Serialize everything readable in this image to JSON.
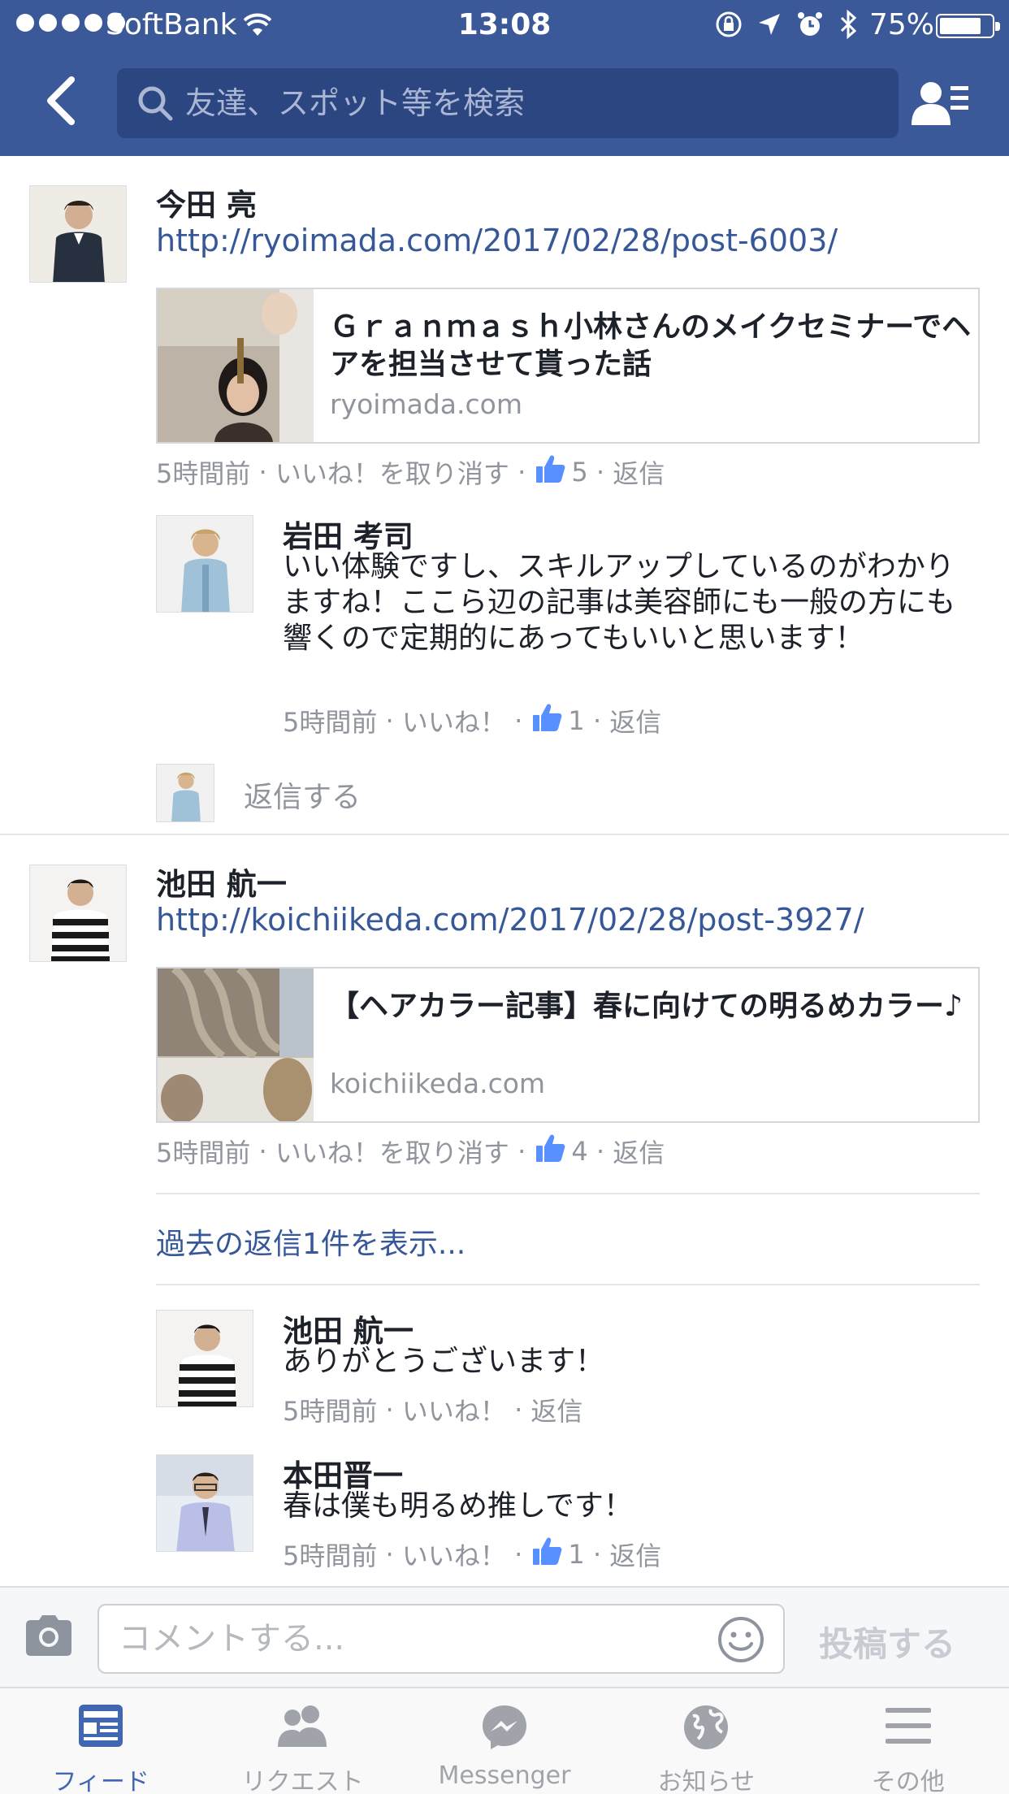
{
  "status_bar": {
    "carrier": "SoftBank",
    "time": "13:08",
    "battery": "75%",
    "battery_level": 0.75
  },
  "nav": {
    "search_placeholder": "友達、スポット等を検索"
  },
  "posts": [
    {
      "author": "今田 亮",
      "link": "http://ryoimada.com/2017/02/28/post-6003/",
      "card": {
        "title": "Ｇｒａｎｍａｓｈ小林さんのメイクセミナーでヘアを担当させて貰った話",
        "domain": "ryoimada.com"
      },
      "meta": {
        "time": "5時間前",
        "like": "いいね！を取り消す",
        "likes": "5",
        "reply": "返信"
      },
      "replies": [
        {
          "author": "岩田 考司",
          "text": "いい体験ですし、スキルアップしているのがわかりますね！ここら辺の記事は美容師にも一般の方にも響くので定期的にあってもいいと思います！",
          "time": "5時間前",
          "like": "いいね！",
          "likes": "1",
          "reply": "返信"
        }
      ],
      "reply_prompt": "返信する"
    },
    {
      "author": "池田 航一",
      "link": "http://koichiikeda.com/2017/02/28/post-3927/",
      "card": {
        "title": "【ヘアカラー記事】春に向けての明るめカラー♪",
        "domain": "koichiikeda.com"
      },
      "meta": {
        "time": "5時間前",
        "like": "いいね！を取り消す",
        "likes": "4",
        "reply": "返信"
      },
      "show_previous": "過去の返信1件を表示...",
      "replies": [
        {
          "author": "池田 航一",
          "text": "ありがとうございます！",
          "time": "5時間前",
          "like": "いいね！",
          "reply": "返信"
        },
        {
          "author": "本田晋一",
          "text": "春は僕も明るめ推しです！",
          "time": "5時間前",
          "like": "いいね！",
          "likes": "1",
          "reply": "返信"
        }
      ]
    }
  ],
  "composer": {
    "placeholder": "コメントする...",
    "post_label": "投稿する"
  },
  "tabs": [
    {
      "label": "フィード",
      "icon": "feed-icon",
      "active": true
    },
    {
      "label": "リクエスト",
      "icon": "friend-requests-icon",
      "active": false
    },
    {
      "label": "Messenger",
      "icon": "messenger-icon",
      "active": false
    },
    {
      "label": "お知らせ",
      "icon": "globe-icon",
      "active": false
    },
    {
      "label": "その他",
      "icon": "menu-icon",
      "active": false
    }
  ],
  "colors": {
    "brand": "#3b5998",
    "link": "#365899",
    "meta": "#90949c",
    "active_tab": "#4267b2"
  }
}
